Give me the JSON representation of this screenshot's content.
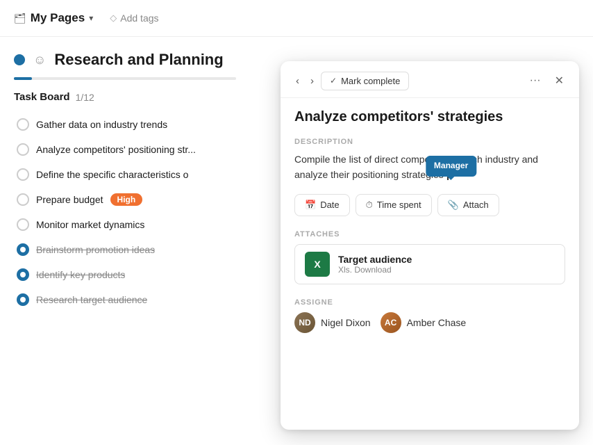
{
  "topbar": {
    "folder_label": "My Pages",
    "chevron": "▾",
    "add_tags_label": "Add tags"
  },
  "page": {
    "title": "Research and Planning",
    "task_board_label": "Task Board",
    "task_board_count": "1/12"
  },
  "tasks": [
    {
      "id": 1,
      "text": "Gather data on industry trends",
      "completed": false,
      "priority": null
    },
    {
      "id": 2,
      "text": "Analyze competitors' positioning str...",
      "completed": false,
      "priority": null
    },
    {
      "id": 3,
      "text": "Define the specific characteristics o",
      "completed": false,
      "priority": null
    },
    {
      "id": 4,
      "text": "Prepare budget",
      "completed": false,
      "priority": "High"
    },
    {
      "id": 5,
      "text": "Monitor market dynamics",
      "completed": false,
      "priority": null
    },
    {
      "id": 6,
      "text": "Brainstorm promotion ideas",
      "completed": true,
      "priority": null
    },
    {
      "id": 7,
      "text": "Identify key products",
      "completed": true,
      "priority": null
    },
    {
      "id": 8,
      "text": "Research target audience",
      "completed": true,
      "priority": null
    }
  ],
  "detail_panel": {
    "title": "Analyze competitors' strategies",
    "mark_complete_label": "Mark complete",
    "description_label": "DESCRIPTION",
    "description_text": "Compile the list of direct competitors in tech industry and analyze their positioning strategies",
    "tooltip_label": "Manager",
    "action_date": "Date",
    "action_time": "Time spent",
    "action_attach": "Attach",
    "attaches_label": "ATTACHES",
    "attach_name": "Target audience",
    "attach_meta": "Xls. Download",
    "assignee_label": "ASSIGNE",
    "assignees": [
      {
        "name": "Nigel Dixon",
        "initials": "ND"
      },
      {
        "name": "Amber Chase",
        "initials": "AC"
      }
    ]
  }
}
